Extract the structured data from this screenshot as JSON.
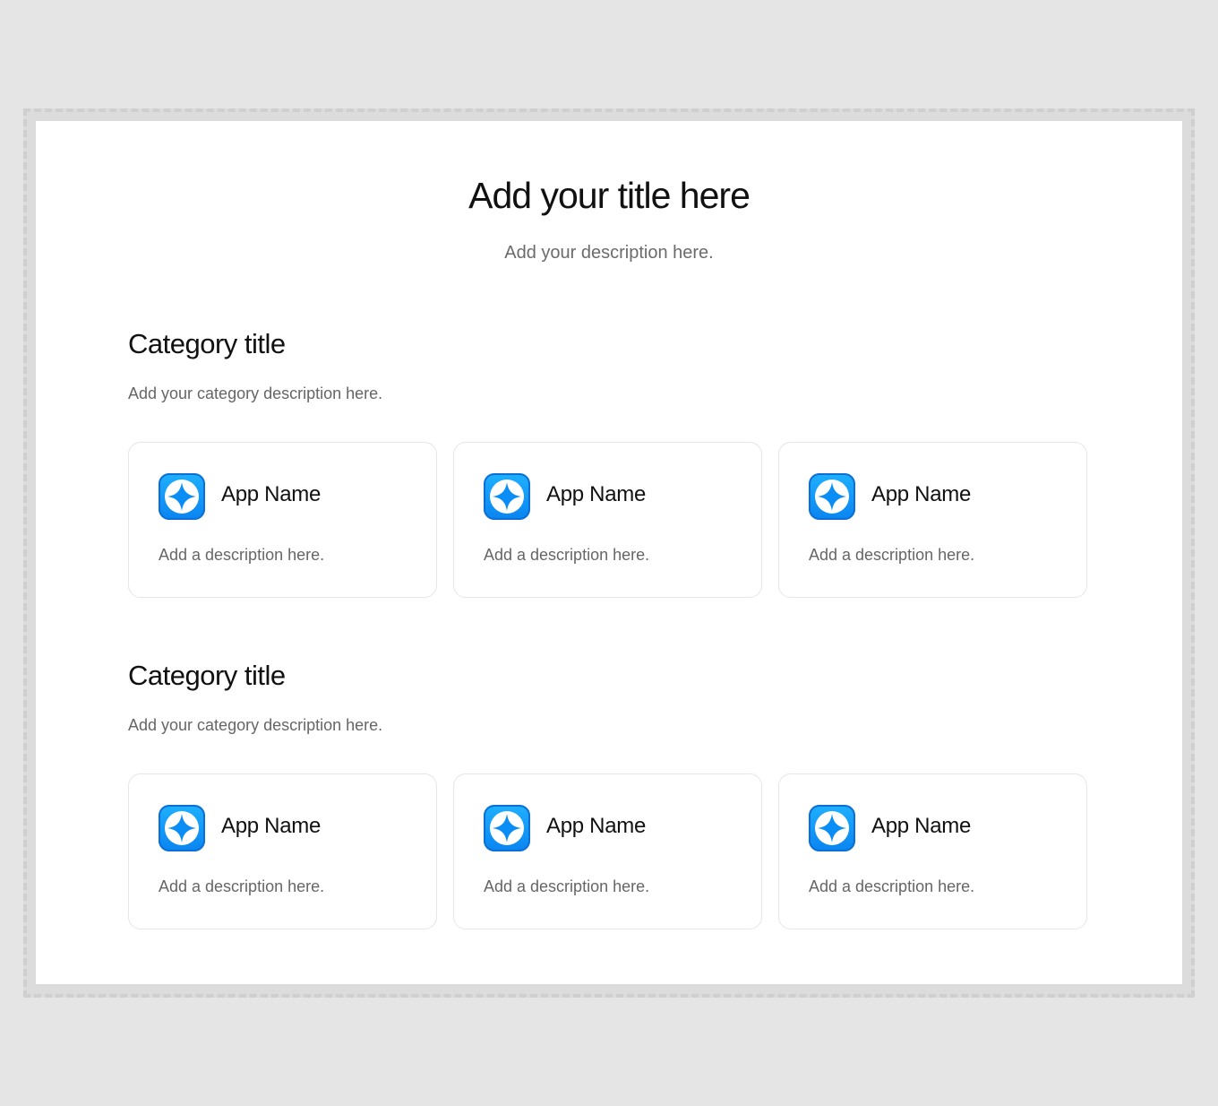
{
  "page": {
    "title": "Add your title here",
    "description": "Add your description here."
  },
  "categories": [
    {
      "title": "Category title",
      "description": "Add your category description here.",
      "apps": [
        {
          "name": "App Name",
          "description": "Add a description here.",
          "icon": "app-star-icon"
        },
        {
          "name": "App Name",
          "description": "Add a description here.",
          "icon": "app-star-icon"
        },
        {
          "name": "App Name",
          "description": "Add a description here.",
          "icon": "app-star-icon"
        }
      ]
    },
    {
      "title": "Category title",
      "description": "Add your category description here.",
      "apps": [
        {
          "name": "App Name",
          "description": "Add a description here.",
          "icon": "app-star-icon"
        },
        {
          "name": "App Name",
          "description": "Add a description here.",
          "icon": "app-star-icon"
        },
        {
          "name": "App Name",
          "description": "Add a description here.",
          "icon": "app-star-icon"
        }
      ]
    }
  ],
  "colors": {
    "icon_gradient_top": "#1fb0ff",
    "icon_gradient_bottom": "#0a84f0",
    "icon_border": "#0b6fd6",
    "background": "#e5e5e5",
    "canvas": "#ffffff"
  }
}
